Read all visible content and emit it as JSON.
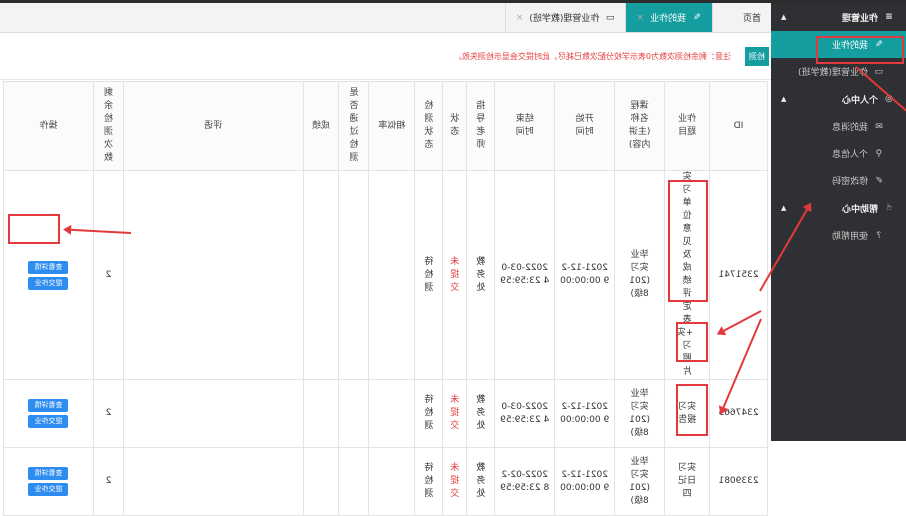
{
  "sidebar": {
    "groups": [
      {
        "label": "作业管理",
        "items": [
          {
            "label": "我的作业"
          },
          {
            "label": "作业管理(教学班)"
          }
        ]
      },
      {
        "label": "个人中心",
        "items": [
          {
            "label": "我的消息"
          },
          {
            "label": "个人信息"
          },
          {
            "label": "修改密码"
          }
        ]
      },
      {
        "label": "帮助中心",
        "items": [
          {
            "label": "使用帮助"
          }
        ]
      }
    ]
  },
  "tabs": [
    {
      "label": "首页"
    },
    {
      "label": "我的作业"
    },
    {
      "label": "作业管理(教学班)"
    }
  ],
  "toolbar": {
    "button_label": "检测",
    "notice": "注意：剩余检测次数为0表示学校分配次数已耗尽，此时提交会显示检测失败。"
  },
  "table": {
    "headers": [
      "ID",
      "作业题目",
      "课程名称(主讲内容)",
      "开始时间",
      "结束时间",
      "指导老师",
      "状态",
      "检测状态",
      "相似率",
      "是否通过检测",
      "成绩",
      "评语",
      "剩余检测次数",
      "操作"
    ],
    "rows": [
      {
        "id": "2351741",
        "title": "实习单位意见及成绩评定表+实习照片",
        "course": "毕业实习(2018级)",
        "start": "2021-12-29 00:00:00",
        "end": "2022-03-04 23:59:59",
        "teacher": "教务处",
        "status": "未提交",
        "check": "待检测",
        "remaining": "2"
      },
      {
        "id": "2347665",
        "title": "实习报告",
        "course": "毕业实习(2018级)",
        "start": "2021-12-29 00:00:00",
        "end": "2022-03-04 23:59:59",
        "teacher": "教务处",
        "status": "未提交",
        "check": "待检测",
        "remaining": "2"
      },
      {
        "id": "2339081",
        "title": "实习日记四",
        "course": "毕业实习(2018级)",
        "start": "2021-12-29 00:00:00",
        "end": "2022-02-28 23:59:59",
        "teacher": "教务处",
        "status": "未提交",
        "check": "待检测",
        "remaining": "2"
      }
    ],
    "actions": {
      "view": "查看详情",
      "submit": "提交作业"
    }
  },
  "colors": {
    "accent": "#159ea0",
    "annotation": "#e4393c",
    "action_button": "#2d8cf0"
  }
}
